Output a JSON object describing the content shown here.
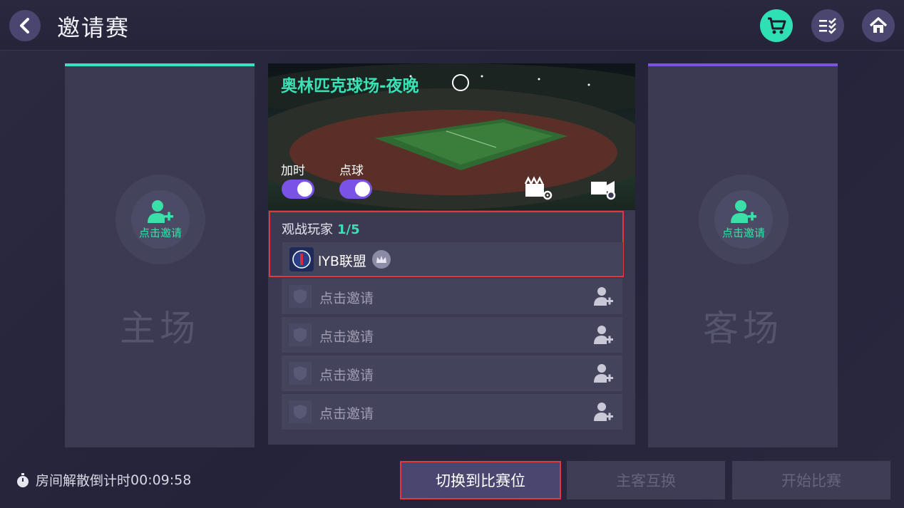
{
  "header": {
    "title": "邀请赛"
  },
  "home": {
    "invite_label": "点击邀请",
    "title": "主场"
  },
  "away": {
    "invite_label": "点击邀请",
    "title": "客场"
  },
  "stadium": {
    "name": "奥林匹克球场-夜晚",
    "toggles": [
      {
        "label": "加时",
        "on": true
      },
      {
        "label": "点球",
        "on": true
      }
    ]
  },
  "spectators": {
    "title": "观战玩家",
    "count": "1/5",
    "player": {
      "name": "lYB联盟"
    },
    "empty_slots": [
      {
        "label": "点击邀请"
      },
      {
        "label": "点击邀请"
      },
      {
        "label": "点击邀请"
      },
      {
        "label": "点击邀请"
      }
    ]
  },
  "footer": {
    "countdown_label": "房间解散倒计时",
    "countdown_value": "00:09:58",
    "switch_button": "切换到比赛位",
    "swap_button": "主客互换",
    "start_button": "开始比赛"
  },
  "colors": {
    "accent_green": "#3be0b4",
    "accent_purple": "#7b52e6",
    "highlight_red": "#e03a3a"
  }
}
